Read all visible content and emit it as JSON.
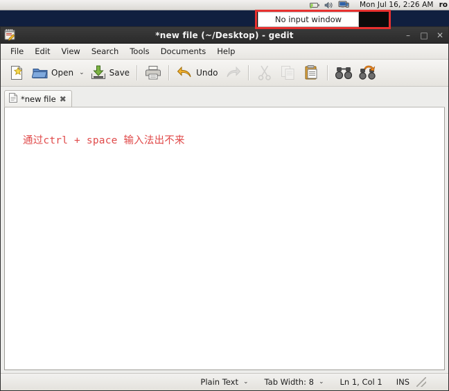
{
  "panel": {
    "clock": "Mon Jul 16,  2:26 AM",
    "user": "ro",
    "tray_icons": [
      "battery-icon",
      "volume-icon",
      "display-icon"
    ]
  },
  "annotation": {
    "tooltip_text": "No input window",
    "highlight_color": "#e8312f"
  },
  "window": {
    "title": "*new file (~/Desktop) - gedit",
    "app_icon": "gedit-icon",
    "controls": {
      "minimize": "–",
      "maximize": "□",
      "close": "✕"
    }
  },
  "menubar": {
    "items": [
      {
        "label": "File"
      },
      {
        "label": "Edit"
      },
      {
        "label": "View"
      },
      {
        "label": "Search"
      },
      {
        "label": "Tools"
      },
      {
        "label": "Documents"
      },
      {
        "label": "Help"
      }
    ]
  },
  "toolbar": {
    "new_icon": "new-document-icon",
    "open_label": "Open",
    "open_icon": "open-folder-icon",
    "open_chevron": "⌄",
    "save_label": "Save",
    "save_icon": "save-icon",
    "print_icon": "print-icon",
    "undo_label": "Undo",
    "undo_icon": "undo-icon",
    "redo_icon": "redo-icon",
    "cut_icon": "cut-icon",
    "copy_icon": "copy-icon",
    "paste_icon": "paste-icon",
    "find_icon": "find-icon",
    "replace_icon": "replace-icon"
  },
  "tabs": [
    {
      "label": "*new file",
      "icon": "text-file-icon",
      "close": "✖"
    }
  ],
  "editor": {
    "content": "通过ctrl + space 输入法出不来",
    "text_color": "#e04a4a"
  },
  "statusbar": {
    "language": "Plain Text",
    "language_chevron": "⌄",
    "tab_width": "Tab Width: 8",
    "tab_width_chevron": "⌄",
    "cursor_position": "Ln 1, Col 1",
    "insert_mode": "INS"
  }
}
